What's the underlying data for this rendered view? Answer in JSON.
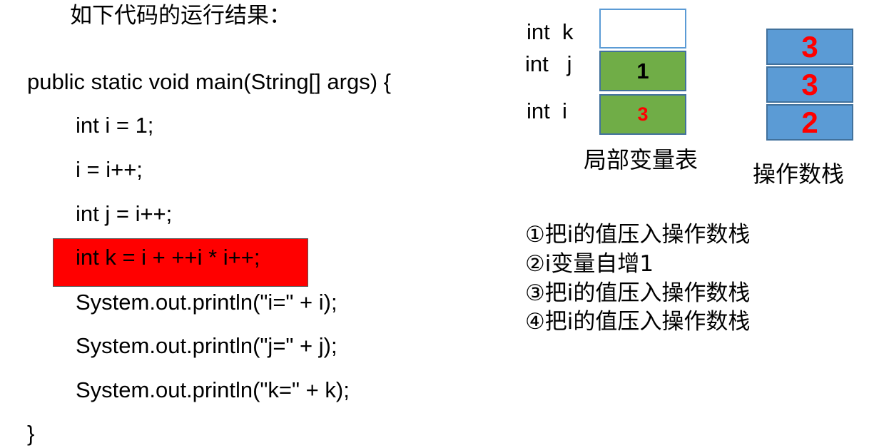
{
  "heading": "如下代码的运行结果：",
  "code": {
    "line1": "public static void main(String[] args) {",
    "line2": "int i = 1;",
    "line3": "i = i++;",
    "line4": "int j = i++;",
    "line5": "int k = i + ++i * i++;",
    "line6": "System.out.println(\"i=\" + i);",
    "line7": "System.out.println(\"j=\" + j);",
    "line8": "System.out.println(\"k=\" + k);",
    "line9": "}"
  },
  "colors": {
    "highlight": "#ff0000",
    "local_var_cell": "#70ad47",
    "stack_cell": "#5b9bd5",
    "value_text": "#ff0000"
  },
  "local_vars": {
    "k_label": "int  k",
    "j_label": "int   j",
    "i_label": "int  i",
    "k_value": "",
    "j_value": "1",
    "i_value": "3",
    "caption": "局部变量表"
  },
  "operand_stack": {
    "items": [
      "3",
      "3",
      "2"
    ],
    "caption": "操作数栈"
  },
  "steps": [
    "①把i的值压入操作数栈",
    "②i变量自增1",
    "③把i的值压入操作数栈",
    "④把i的值压入操作数栈"
  ]
}
